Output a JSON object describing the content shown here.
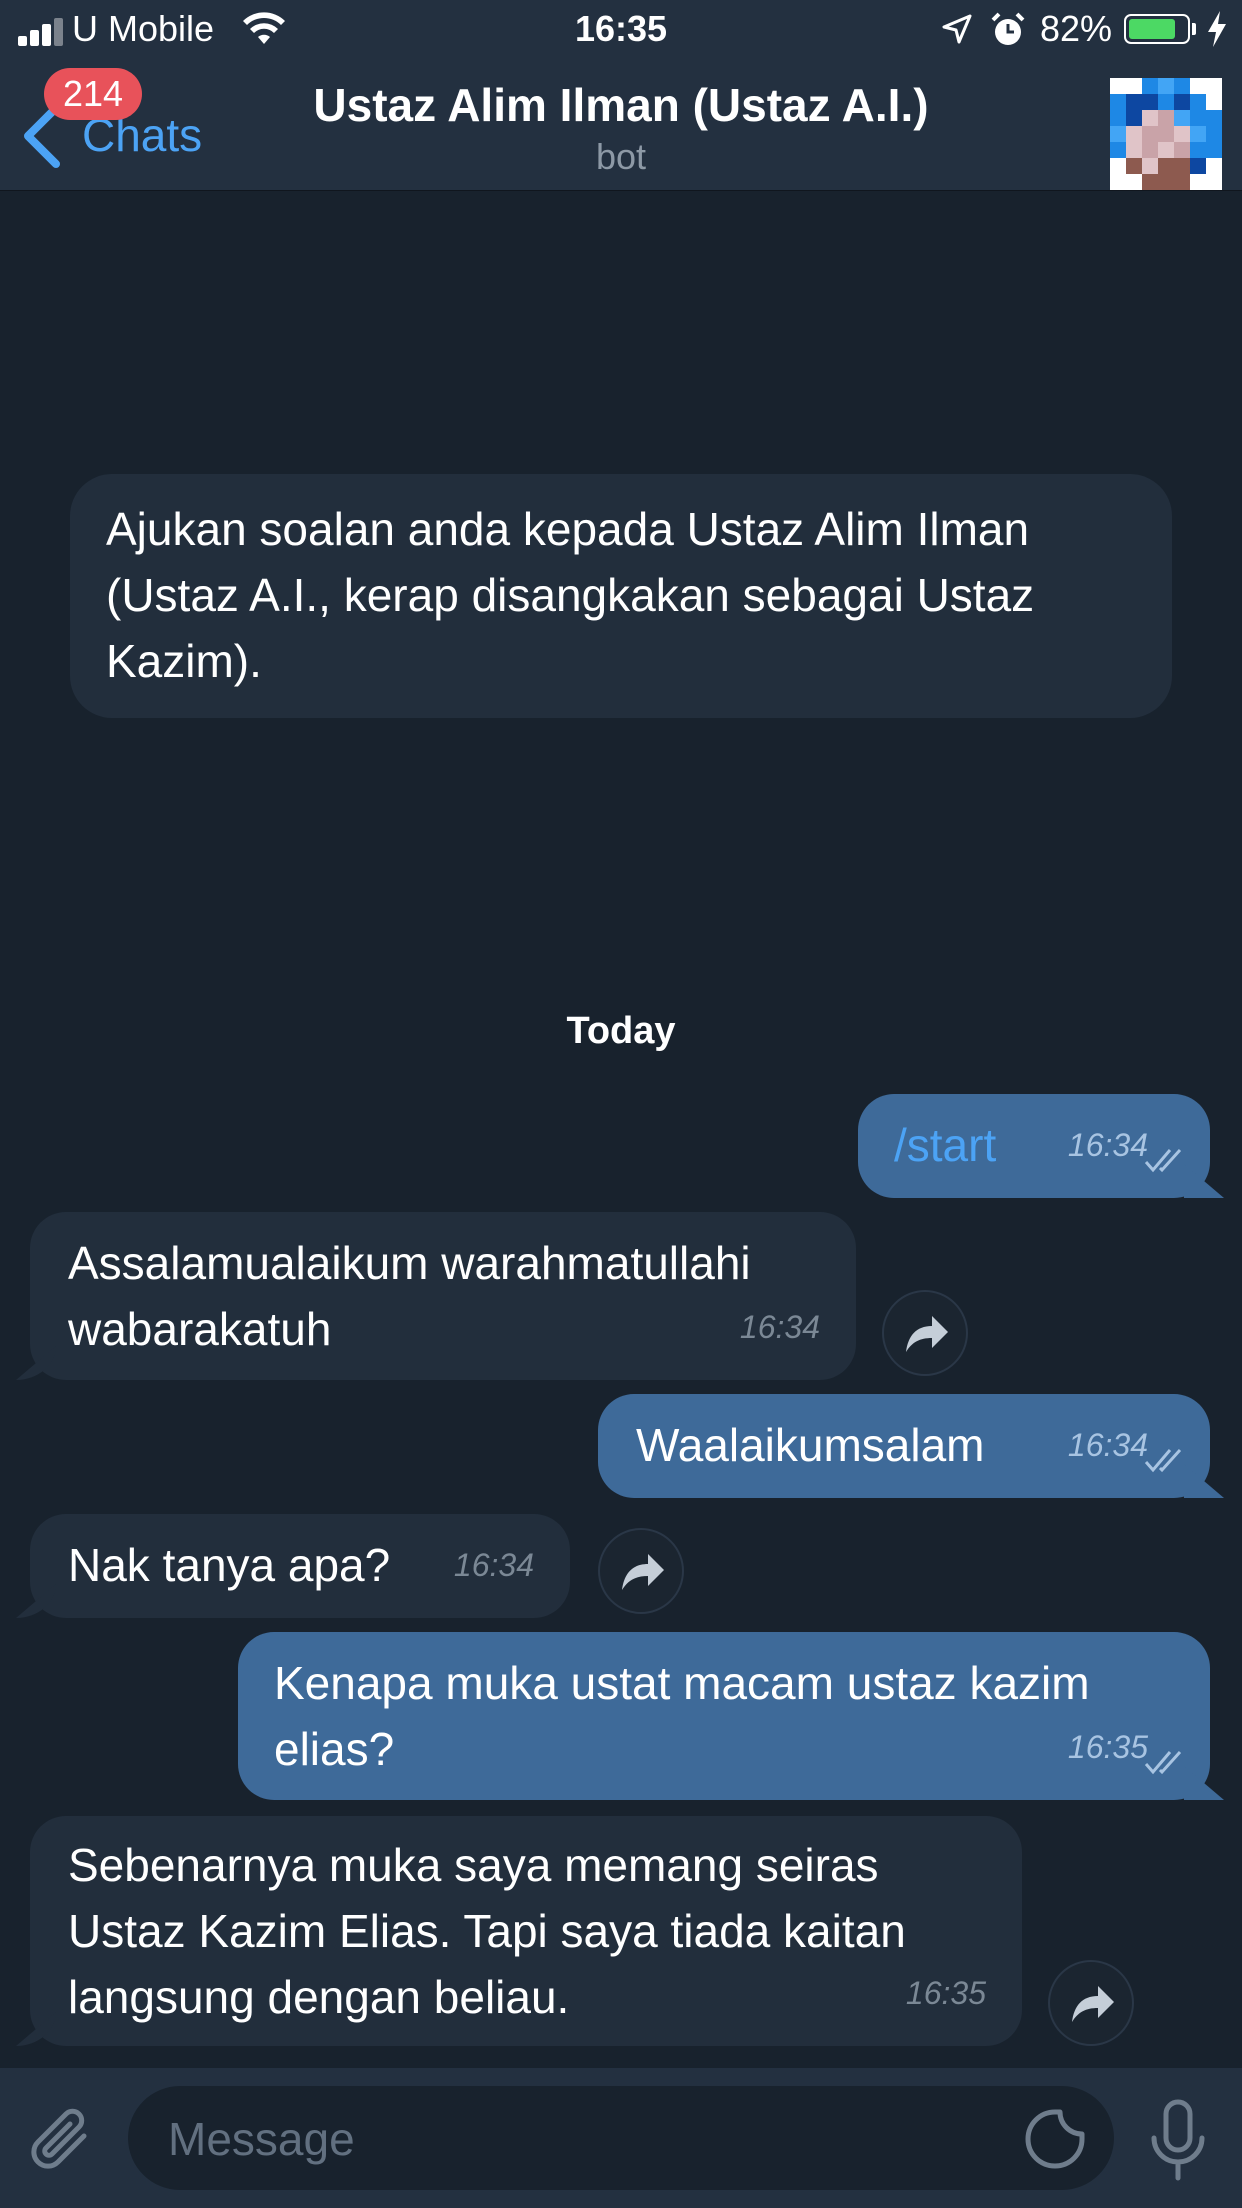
{
  "status_bar": {
    "carrier": "U Mobile",
    "time": "16:35",
    "battery_percent": "82%",
    "battery_level": 0.82,
    "icons": [
      "signal-icon",
      "wifi-icon",
      "location-arrow-icon",
      "alarm-icon",
      "battery-icon",
      "charging-bolt-icon"
    ]
  },
  "header": {
    "back_label": "Chats",
    "unread_badge": "214",
    "title": "Ustaz Alim Ilman (Ustaz A.I.)",
    "subtitle": "bot"
  },
  "intro_message": "Ajukan soalan anda kepada Ustaz Alim Ilman\n(Ustaz A.I., kerap disangkakan sebagai Ustaz\nKazim).",
  "date_separator": "Today",
  "messages": [
    {
      "direction": "out",
      "text": "/start",
      "time": "16:34",
      "read": true
    },
    {
      "direction": "in",
      "text": "Assalamualaikum warahmatullahi\nwabarakatuh",
      "time": "16:34"
    },
    {
      "direction": "out",
      "text": "Waalaikumsalam",
      "time": "16:34",
      "read": true
    },
    {
      "direction": "in",
      "text": "Nak tanya apa?",
      "time": "16:34"
    },
    {
      "direction": "out",
      "text": "Kenapa muka ustat macam ustaz kazim\nelias?",
      "time": "16:35",
      "read": true
    },
    {
      "direction": "in",
      "text": "Sebenarnya muka saya memang seiras\nUstaz Kazim Elias. Tapi saya tiada kaitan\nlangsung dengan beliau.",
      "time": "16:35"
    }
  ],
  "input": {
    "placeholder": "Message"
  },
  "colors": {
    "background": "#18222d",
    "bar": "#233040",
    "incoming_bubble": "#222e3c",
    "outgoing_bubble": "#3e6a99",
    "accent": "#4ca3f5",
    "badge": "#e8525a"
  }
}
